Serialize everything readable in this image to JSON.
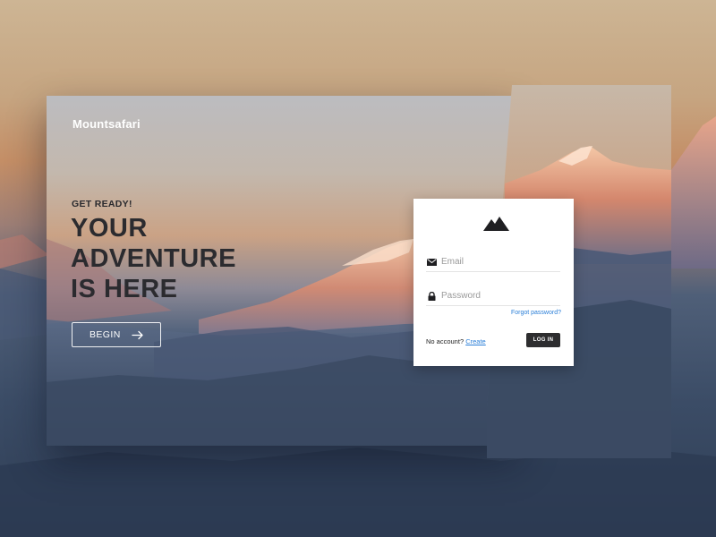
{
  "brand": {
    "name": "Mountsafari"
  },
  "hero": {
    "eyebrow": "GET READY!",
    "headline_lines": [
      "YOUR",
      "ADVENTURE",
      "IS HERE"
    ],
    "cta_label": "BEGIN"
  },
  "login": {
    "email_placeholder": "Email",
    "password_placeholder": "Password",
    "forgot_label": "Forgot password?",
    "no_account_text": "No account?",
    "create_label": "Create",
    "login_label": "LOG IN"
  },
  "icons": {
    "brand": "mountain-icon",
    "email": "mail-icon",
    "password": "lock-icon",
    "cta": "arrow-right-icon"
  }
}
